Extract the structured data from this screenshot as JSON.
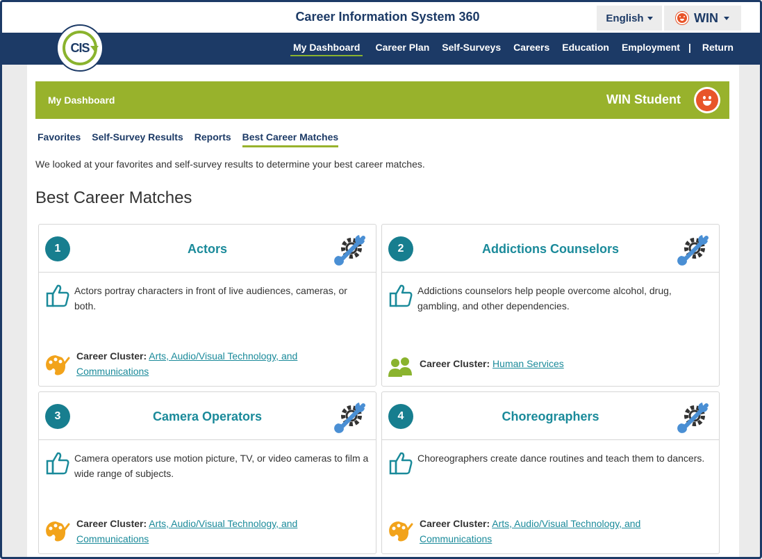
{
  "header": {
    "app_title": "Career Information System 360",
    "language_label": "English",
    "user_label": "WIN",
    "logo_text": "CIS"
  },
  "nav": {
    "items": [
      {
        "label": "My Dashboard",
        "active": true
      },
      {
        "label": "Career Plan"
      },
      {
        "label": "Self-Surveys"
      },
      {
        "label": "Careers"
      },
      {
        "label": "Education"
      },
      {
        "label": "Employment"
      }
    ],
    "separator": "|",
    "return_label": "Return"
  },
  "banner": {
    "title": "My Dashboard",
    "user_name": "WIN Student"
  },
  "tabs": [
    {
      "label": "Favorites"
    },
    {
      "label": "Self-Survey Results"
    },
    {
      "label": "Reports"
    },
    {
      "label": "Best Career Matches",
      "active": true
    }
  ],
  "intro_text": "We looked at your favorites and self-survey results to determine your best career matches.",
  "section_title": "Best Career Matches",
  "cluster_label": "Career Cluster:",
  "cards": [
    {
      "rank": "1",
      "title": "Actors",
      "description": "Actors portray characters in front of live audiences, cameras, or both.",
      "cluster": "Arts, Audio/Visual Technology, and Communications",
      "cluster_icon": "palette-icon"
    },
    {
      "rank": "2",
      "title": "Addictions Counselors",
      "description": "Addictions counselors help people overcome alcohol, drug, gambling, and other dependencies.",
      "cluster": "Human Services",
      "cluster_icon": "people-icon"
    },
    {
      "rank": "3",
      "title": "Camera Operators",
      "description": "Camera operators use motion picture, TV, or video cameras to film a wide range of subjects.",
      "cluster": "Arts, Audio/Visual Technology, and Communications",
      "cluster_icon": "palette-icon"
    },
    {
      "rank": "4",
      "title": "Choreographers",
      "description": "Choreographers create dance routines and teach them to dancers.",
      "cluster": "Arts, Audio/Visual Technology, and Communications",
      "cluster_icon": "palette-icon"
    }
  ],
  "colors": {
    "navy": "#1c3a66",
    "green": "#98b22c",
    "teal": "#1a8a9a",
    "rank_teal": "#177e8f",
    "orange": "#f2a31b",
    "avatar_orange": "#e8552a"
  }
}
